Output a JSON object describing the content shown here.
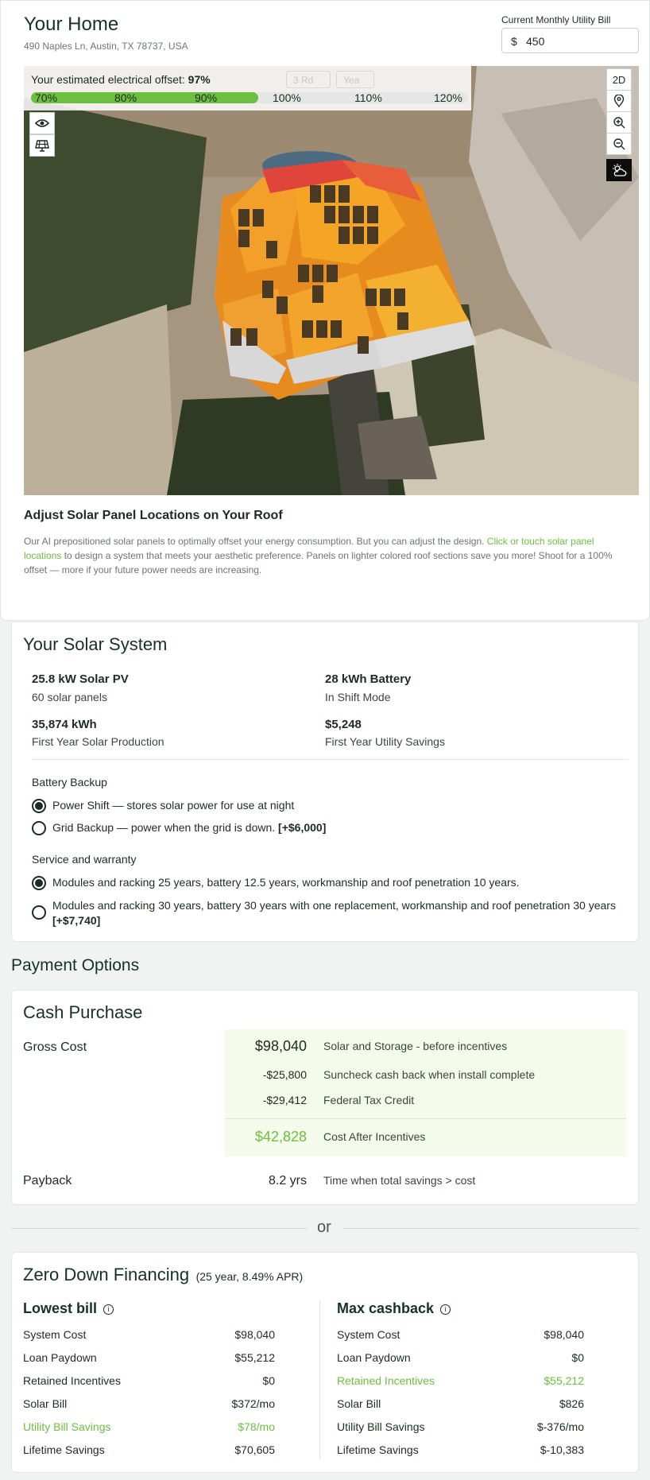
{
  "header": {
    "title": "Your Home",
    "address": "490 Naples Ln, Austin, TX 78737, USA",
    "bill_label": "Current Monthly Utility Bill",
    "bill_currency": "$",
    "bill_value": "450"
  },
  "offset": {
    "label": "Your estimated electrical offset:",
    "value": "97%",
    "percent": 97,
    "ticks": [
      "70%",
      "80%",
      "90%",
      "100%",
      "110%",
      "120%"
    ],
    "ghost_buttons": [
      "3 Rd",
      "Yea"
    ]
  },
  "map_controls": {
    "mode_label": "2D"
  },
  "adjust": {
    "title": "Adjust Solar Panel Locations on Your Roof",
    "text_before": "Our AI prepositioned solar panels to optimally offset your energy consumption. But you can adjust the design. ",
    "link": "Click or touch solar panel locations",
    "text_after": " to design a system that meets your aesthetic preference. Panels on lighter colored roof sections save you more! Shoot for a 100% offset — more if your future power needs are increasing."
  },
  "system": {
    "title": "Your Solar System",
    "stats": [
      {
        "value": "25.8 kW Solar PV",
        "label": "60 solar panels"
      },
      {
        "value": "28 kWh Battery",
        "label": "In Shift Mode"
      },
      {
        "value": "35,874 kWh",
        "label": "First Year Solar Production"
      },
      {
        "value": "$5,248",
        "label": "First Year Utility Savings"
      }
    ],
    "battery_title": "Battery Backup",
    "battery_opts": [
      {
        "text": "Power Shift — stores solar power for use at night",
        "extra": "",
        "selected": true
      },
      {
        "text": "Grid Backup — power when the grid is down.",
        "extra": "[+$6,000]",
        "selected": false
      }
    ],
    "warranty_title": "Service and warranty",
    "warranty_opts": [
      {
        "text": "Modules and racking 25 years, battery 12.5 years, workmanship and roof penetration 10 years.",
        "extra": "",
        "selected": true
      },
      {
        "text": "Modules and racking 30 years, battery 30 years with one replacement, workmanship and roof penetration 30 years",
        "extra": "[+$7,740]",
        "selected": false
      }
    ]
  },
  "payment": {
    "title": "Payment Options",
    "cash_title": "Cash Purchase",
    "gross_label": "Gross Cost",
    "lines": [
      {
        "amount": "$98,040",
        "desc": "Solar and Storage - before incentives"
      },
      {
        "amount": "-$25,800",
        "desc": "Suncheck cash back when install complete"
      },
      {
        "amount": "-$29,412",
        "desc": "Federal Tax Credit"
      }
    ],
    "after": {
      "amount": "$42,828",
      "desc": "Cost After Incentives"
    },
    "payback_label": "Payback",
    "payback_value": "8.2 yrs",
    "payback_desc": "Time when total savings > cost",
    "or": "or"
  },
  "financing": {
    "title": "Zero Down Financing",
    "terms": "(25 year, 8.49% APR)",
    "lowest": {
      "title": "Lowest bill",
      "rows": [
        {
          "label": "System Cost",
          "value": "$98,040",
          "hl": false
        },
        {
          "label": "Loan Paydown",
          "value": "$55,212",
          "hl": false
        },
        {
          "label": "Retained Incentives",
          "value": "$0",
          "hl": false
        },
        {
          "label": "Solar Bill",
          "value": "$372/mo",
          "hl": false
        },
        {
          "label": "Utility Bill Savings",
          "value": "$78/mo",
          "hl": true
        },
        {
          "label": "Lifetime Savings",
          "value": "$70,605",
          "hl": false
        }
      ]
    },
    "max": {
      "title": "Max cashback",
      "rows": [
        {
          "label": "System Cost",
          "value": "$98,040",
          "hl": false
        },
        {
          "label": "Loan Paydown",
          "value": "$0",
          "hl": false
        },
        {
          "label": "Retained Incentives",
          "value": "$55,212",
          "hl": true
        },
        {
          "label": "Solar Bill",
          "value": "$826",
          "hl": false
        },
        {
          "label": "Utility Bill Savings",
          "value": "$-376/mo",
          "hl": false
        },
        {
          "label": "Lifetime Savings",
          "value": "$-10,383",
          "hl": false
        }
      ]
    }
  },
  "colors": {
    "accent": "#6cbf3f",
    "text": "#1d2b24"
  }
}
